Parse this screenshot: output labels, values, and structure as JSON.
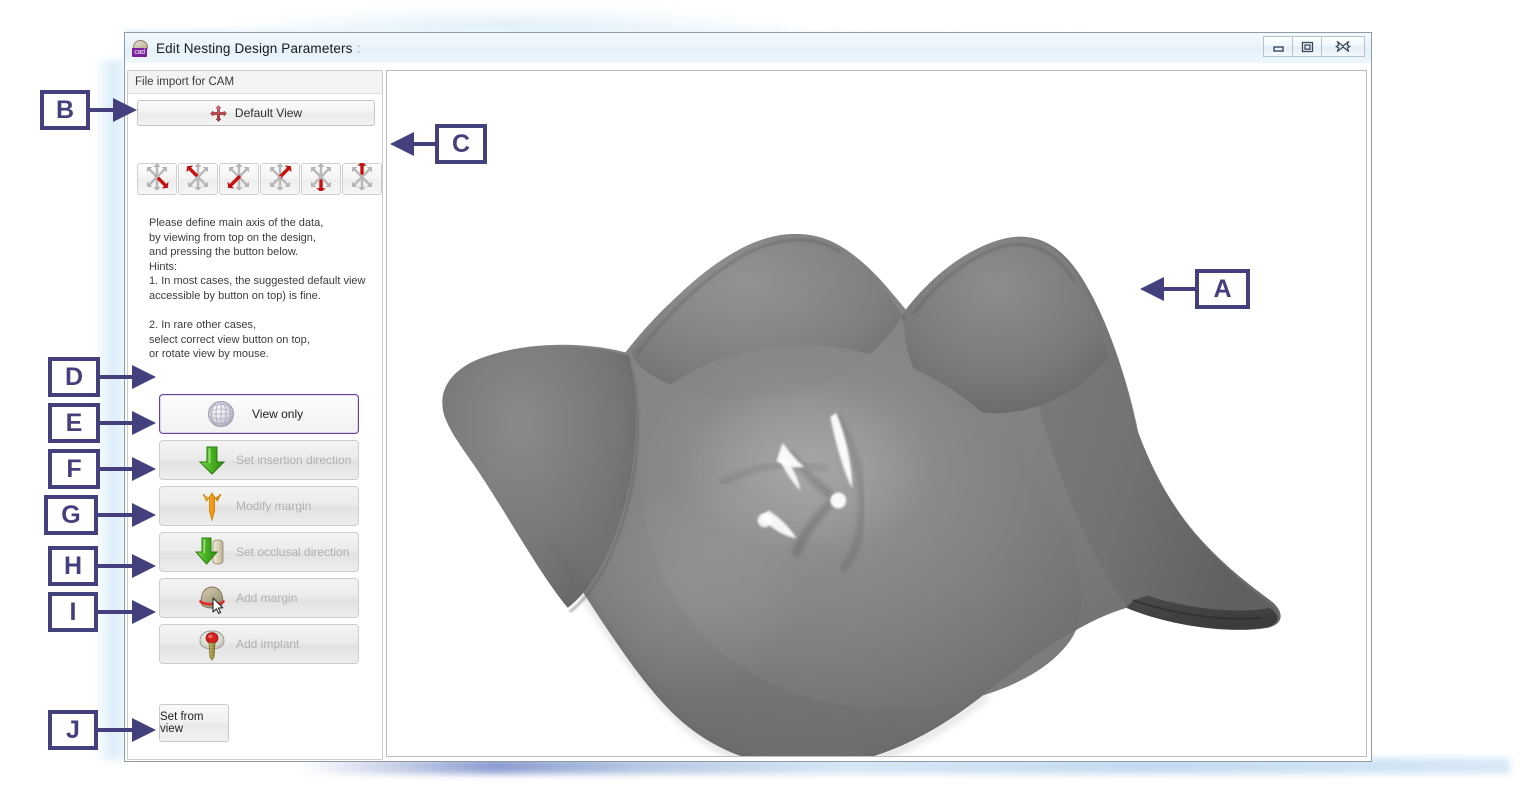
{
  "window": {
    "title": "Edit Nesting Design Parameters",
    "title_suffix": ":",
    "icon": "cad-app-icon",
    "controls": {
      "minimize": "minimize-button",
      "maximize": "maximize-button",
      "close": "close-button"
    }
  },
  "panel": {
    "header": "File import for CAM",
    "default_view_button": "Default View",
    "default_view_icon": "four-way-move-icon",
    "view_buttons": [
      {
        "name": "view-axis-1",
        "label": "",
        "icon": "axis-star-icon",
        "highlight_axis": "down-right"
      },
      {
        "name": "view-axis-2",
        "label": "",
        "icon": "axis-star-icon",
        "highlight_axis": "up-left"
      },
      {
        "name": "view-axis-3",
        "label": "",
        "icon": "axis-star-icon",
        "highlight_axis": "down-left"
      },
      {
        "name": "view-axis-4",
        "label": "",
        "icon": "axis-star-icon",
        "highlight_axis": "up-right"
      },
      {
        "name": "view-axis-5",
        "label": "",
        "icon": "axis-star-icon",
        "highlight_axis": "down"
      },
      {
        "name": "view-axis-6",
        "label": "",
        "icon": "axis-star-icon",
        "highlight_axis": "up"
      }
    ],
    "hint_text": "Please define main axis of the data,\nby viewing from top on the design,\nand pressing the button below.\nHints:\n1. In most cases, the suggested default view\naccessible by button on top) is fine.\n\n2. In rare other cases,\nselect correct view button on top,\nor rotate view by mouse.",
    "actions": [
      {
        "label": "View only",
        "icon": "wireframe-globe-icon",
        "enabled": true,
        "selected": true
      },
      {
        "label": "Set insertion direction",
        "icon": "green-down-arrow-icon",
        "enabled": false,
        "selected": false
      },
      {
        "label": "Modify margin",
        "icon": "orange-trident-icon",
        "enabled": false,
        "selected": false
      },
      {
        "label": "Set occlusal direction",
        "icon": "green-arrow-tooth-icon",
        "enabled": false,
        "selected": false
      },
      {
        "label": "Add margin",
        "icon": "tooth-margin-cursor-icon",
        "enabled": false,
        "selected": false
      },
      {
        "label": "Add implant",
        "icon": "implant-icon",
        "enabled": false,
        "selected": false
      }
    ],
    "set_from_view_button": "Set from view"
  },
  "viewport": {
    "model": "3d-molar-tooth-mesh",
    "background": "#ffffff"
  },
  "annotations": {
    "accent_color": "#443f7d",
    "items": [
      {
        "letter": "A",
        "target": "3d-model-viewport",
        "direction": "left"
      },
      {
        "letter": "B",
        "target": "default-view-button",
        "direction": "right"
      },
      {
        "letter": "C",
        "target": "view-axis-button-row",
        "direction": "left"
      },
      {
        "letter": "D",
        "target": "view-only-button",
        "direction": "right"
      },
      {
        "letter": "E",
        "target": "set-insertion-direction-button",
        "direction": "right"
      },
      {
        "letter": "F",
        "target": "modify-margin-button",
        "direction": "right"
      },
      {
        "letter": "G",
        "target": "set-occlusal-direction-button",
        "direction": "right"
      },
      {
        "letter": "H",
        "target": "add-margin-button",
        "direction": "right"
      },
      {
        "letter": "I",
        "target": "add-implant-button",
        "direction": "right"
      },
      {
        "letter": "J",
        "target": "set-from-view-button",
        "direction": "right"
      }
    ]
  }
}
